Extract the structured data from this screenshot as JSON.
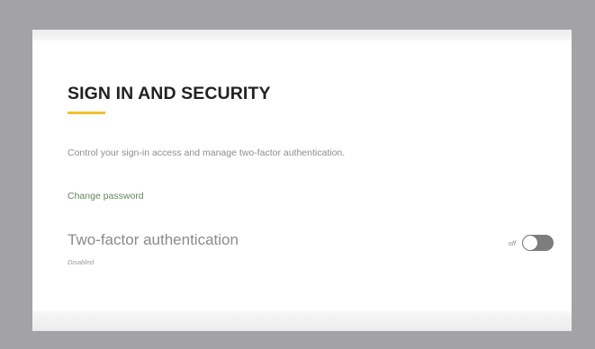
{
  "section": {
    "title": "SIGN IN AND SECURITY",
    "description": "Control your sign-in access and manage two-factor authentication.",
    "change_password_link": "Change password"
  },
  "two_factor": {
    "label": "Two-factor authentication",
    "status": "Disabled",
    "toggle_state_label": "off",
    "enabled": false
  },
  "colors": {
    "accent_underline": "#f2c12e",
    "link": "#5f8a5a",
    "toggle_track_off": "#7d7d7d",
    "outer_frame": "#a3a3a5"
  }
}
